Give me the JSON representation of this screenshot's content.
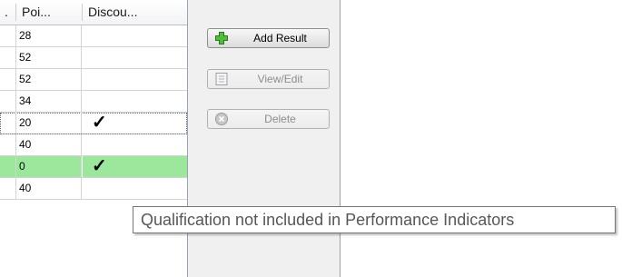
{
  "grid": {
    "columns": [
      {
        "label": "."
      },
      {
        "label": "Poi..."
      },
      {
        "label": "Discou..."
      }
    ],
    "rows": [
      {
        "points": "28",
        "discounted": false
      },
      {
        "points": "52",
        "discounted": false
      },
      {
        "points": "52",
        "discounted": false
      },
      {
        "points": "34",
        "discounted": false
      },
      {
        "points": "20",
        "discounted": true,
        "focused": true
      },
      {
        "points": "40",
        "discounted": false
      },
      {
        "points": "0",
        "discounted": true,
        "selected": true
      },
      {
        "points": "40",
        "discounted": false
      }
    ],
    "check_glyph": "✓",
    "selected_row_color": "#9be79b"
  },
  "actions": {
    "add_result": "Add Result",
    "view_edit": "View/Edit",
    "delete": "Delete"
  },
  "tooltip": {
    "text": "Qualification not included in Performance Indicators"
  }
}
